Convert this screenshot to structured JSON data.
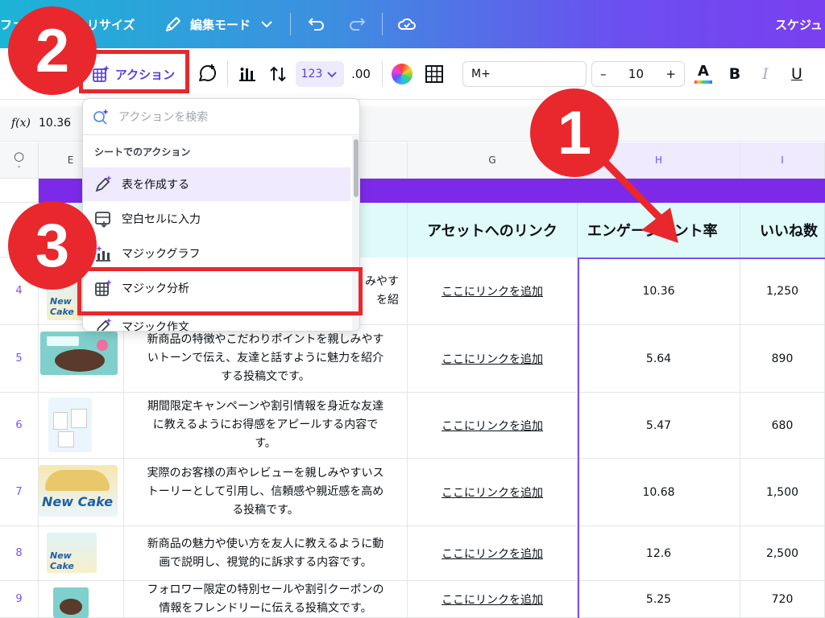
{
  "topbar": {
    "file_label": "ファ",
    "resize_label": "リサイズ",
    "edit_mode_label": "編集モード",
    "schedule_label": "スケジュ"
  },
  "toolbar": {
    "action_label": "アクション",
    "number_format": "123",
    "decimal_label": ".00",
    "font_name": "M+",
    "minus": "–",
    "font_size": "10",
    "plus": "+",
    "text_color_glyph": "A",
    "bold": "B",
    "italic": "I",
    "underline": "U"
  },
  "formula": {
    "fx_label": "f(x)",
    "value": "10.36"
  },
  "dropdown": {
    "search_placeholder": "アクションを検索",
    "section_label": "シートでのアクション",
    "items": [
      {
        "label": "表を作成する",
        "icon": "magic-pencil-icon"
      },
      {
        "label": "空白セルに入力",
        "icon": "fill-cells-icon"
      },
      {
        "label": "マジックグラフ",
        "icon": "magic-chart-icon"
      },
      {
        "label": "マジック分析",
        "icon": "magic-grid-icon"
      },
      {
        "label": "マジック作文",
        "icon": "magic-write-icon"
      }
    ]
  },
  "columns": {
    "corner": "○",
    "e": "E",
    "g": "G",
    "h": "H",
    "i": "I"
  },
  "headers": {
    "link": "アセットへのリンク",
    "engagement": "エンゲージメント率",
    "likes": "いいね数"
  },
  "rows": [
    {
      "num": "4",
      "desc": "みやす\nを紹",
      "link": "ここにリンクを追加",
      "rate": "10.36",
      "likes": "1,250"
    },
    {
      "num": "5",
      "desc": "新商品の特徴やこだわりポイントを親しみやす\nいトーンで伝え、友達と話すように魅力を紹介\nする投稿文です。",
      "link": "ここにリンクを追加",
      "rate": "5.64",
      "likes": "890"
    },
    {
      "num": "6",
      "desc": "期間限定キャンペーンや割引情報を身近な友達\nに教えるようにお得感をアピールする内容で\nす。",
      "link": "ここにリンクを追加",
      "rate": "5.47",
      "likes": "680"
    },
    {
      "num": "7",
      "desc": "実際のお客様の声やレビューを親しみやすいス\nトーリーとして引用し、信頼感や親近感を高め\nる投稿です。",
      "link": "ここにリンクを追加",
      "rate": "10.68",
      "likes": "1,500"
    },
    {
      "num": "8",
      "desc": "新商品の魅力や使い方を友人に教えるように動\n画で説明し、視覚的に訴求する内容です。",
      "link": "ここにリンクを追加",
      "rate": "12.6",
      "likes": "2,500"
    },
    {
      "num": "9",
      "desc": "フォロワー限定の特別セールや割引クーポンの\n情報をフレンドリーに伝える投稿文です。",
      "link": "ここにリンクを追加",
      "rate": "5.25",
      "likes": "720"
    }
  ],
  "thumbs": {
    "new_cake": "New Cake",
    "new_cake_2": "New Cake"
  },
  "annotations": {
    "one": "1",
    "two": "2",
    "three": "3"
  },
  "colors": {
    "accent": "#7a4ff0",
    "band": "#7d2ae8",
    "header_bg": "#dffafa",
    "annotation_red": "#e8282c"
  }
}
